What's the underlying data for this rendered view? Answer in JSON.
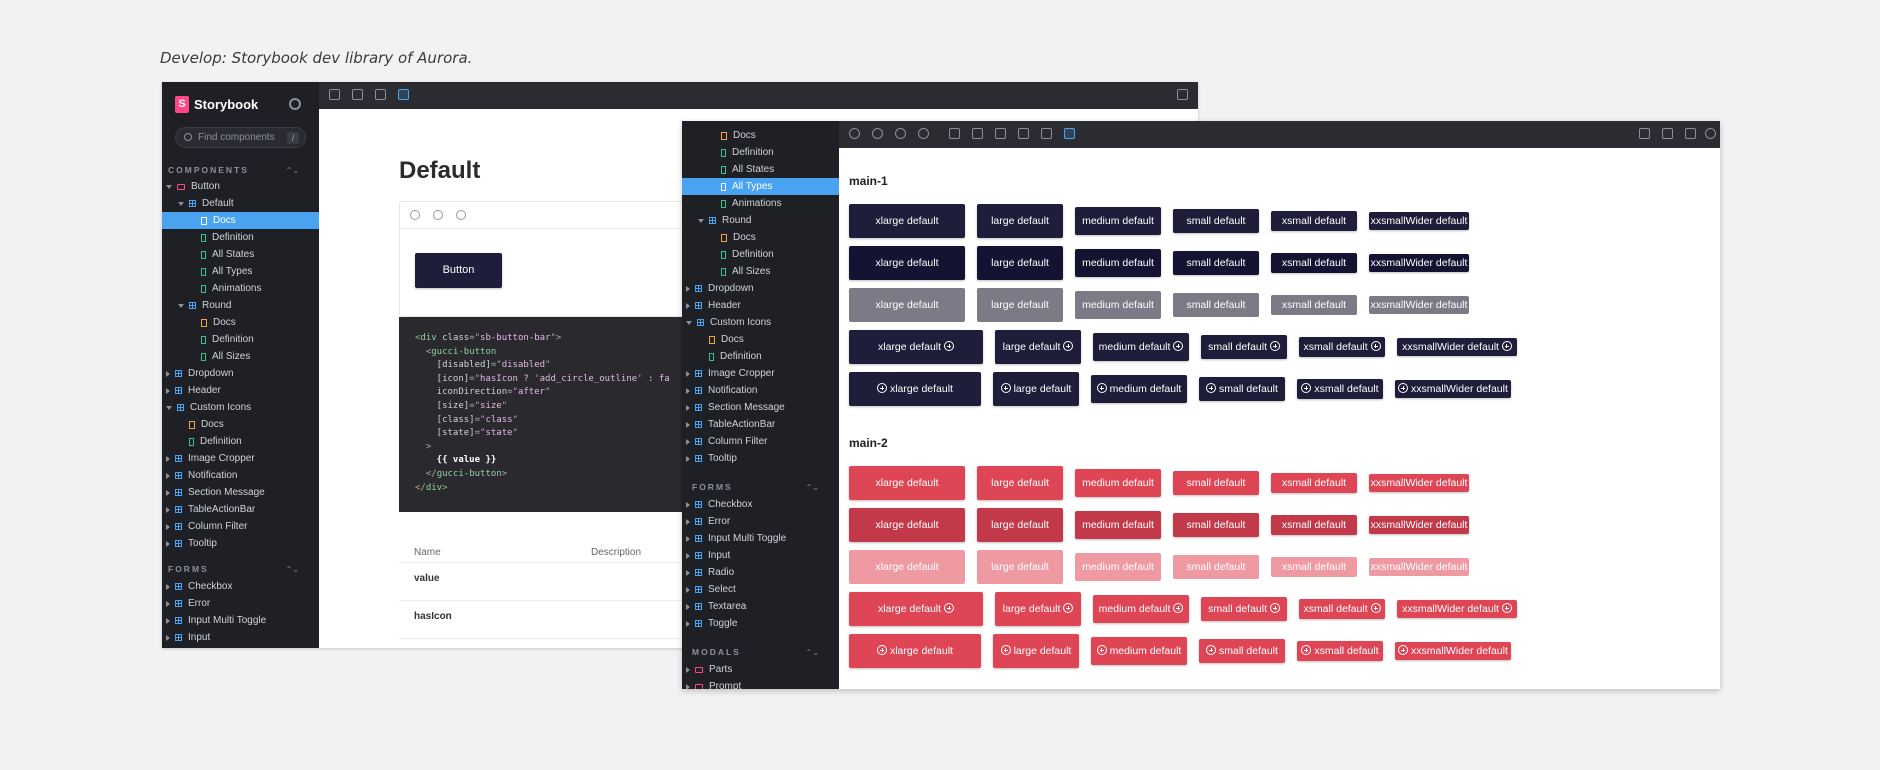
{
  "caption": "Develop: Storybook dev library of Aurora.",
  "storybook": {
    "brand": "Storybook",
    "search_placeholder": "Find components",
    "search_shortcut": "/",
    "section_components": "COMPONENTS",
    "section_forms": "FORMS",
    "section_modals": "MODALS"
  },
  "win1": {
    "tree": [
      {
        "label": "Button",
        "icon": "folder",
        "caret": "down",
        "indent": 0
      },
      {
        "label": "Default",
        "icon": "comp",
        "caret": "down",
        "indent": 1
      },
      {
        "label": "Docs",
        "icon": "doc",
        "indent": 2,
        "selected": true
      },
      {
        "label": "Definition",
        "icon": "story",
        "indent": 2
      },
      {
        "label": "All States",
        "icon": "story",
        "indent": 2
      },
      {
        "label": "All Types",
        "icon": "story",
        "indent": 2
      },
      {
        "label": "Animations",
        "icon": "story",
        "indent": 2
      },
      {
        "label": "Round",
        "icon": "comp",
        "caret": "down",
        "indent": 1
      },
      {
        "label": "Docs",
        "icon": "doc",
        "indent": 2
      },
      {
        "label": "Definition",
        "icon": "story",
        "indent": 2
      },
      {
        "label": "All Sizes",
        "icon": "story",
        "indent": 2
      },
      {
        "label": "Dropdown",
        "icon": "comp",
        "caret": "right",
        "indent": 0
      },
      {
        "label": "Header",
        "icon": "comp",
        "caret": "right",
        "indent": 0
      },
      {
        "label": "Custom Icons",
        "icon": "comp",
        "caret": "down",
        "indent": 0
      },
      {
        "label": "Docs",
        "icon": "doc",
        "indent": 1
      },
      {
        "label": "Definition",
        "icon": "story",
        "indent": 1
      },
      {
        "label": "Image Cropper",
        "icon": "comp",
        "caret": "right",
        "indent": 0
      },
      {
        "label": "Notification",
        "icon": "comp",
        "caret": "right",
        "indent": 0
      },
      {
        "label": "Section Message",
        "icon": "comp",
        "caret": "right",
        "indent": 0
      },
      {
        "label": "TableActionBar",
        "icon": "comp",
        "caret": "right",
        "indent": 0
      },
      {
        "label": "Column Filter",
        "icon": "comp",
        "caret": "right",
        "indent": 0
      },
      {
        "label": "Tooltip",
        "icon": "comp",
        "caret": "right",
        "indent": 0
      }
    ],
    "forms_tree": [
      {
        "label": "Checkbox",
        "icon": "comp",
        "caret": "right",
        "indent": 0
      },
      {
        "label": "Error",
        "icon": "comp",
        "caret": "right",
        "indent": 0
      },
      {
        "label": "Input Multi Toggle",
        "icon": "comp",
        "caret": "right",
        "indent": 0
      },
      {
        "label": "Input",
        "icon": "comp",
        "caret": "right",
        "indent": 0
      }
    ],
    "docs_title": "Default",
    "preview_button_label": "Button",
    "code_lines": [
      [
        [
          "c-pun",
          "<"
        ],
        [
          "c-tag",
          "div "
        ],
        [
          "c-attr",
          "class"
        ],
        [
          "c-pun",
          "=\""
        ],
        [
          "c-str",
          "sb-button-bar"
        ],
        [
          "c-pun",
          "\">"
        ]
      ],
      [
        [
          "c-pun",
          "  <"
        ],
        [
          "c-tag",
          "gucci-button"
        ]
      ],
      [
        [
          "c-attr",
          "    [disabled]"
        ],
        [
          "c-pun",
          "=\""
        ],
        [
          "c-str",
          "disabled"
        ],
        [
          "c-pun",
          "\""
        ]
      ],
      [
        [
          "c-attr",
          "    [icon]"
        ],
        [
          "c-pun",
          "=\""
        ],
        [
          "c-str",
          "hasIcon ? 'add_circle_outline' : fa"
        ]
      ],
      [
        [
          "c-attr",
          "    iconDirection"
        ],
        [
          "c-pun",
          "=\""
        ],
        [
          "c-str",
          "after"
        ],
        [
          "c-pun",
          "\""
        ]
      ],
      [
        [
          "c-attr",
          "    [size]"
        ],
        [
          "c-pun",
          "=\""
        ],
        [
          "c-str",
          "size"
        ],
        [
          "c-pun",
          "\""
        ]
      ],
      [
        [
          "c-attr",
          "    [class]"
        ],
        [
          "c-pun",
          "=\""
        ],
        [
          "c-str",
          "class"
        ],
        [
          "c-pun",
          "\""
        ]
      ],
      [
        [
          "c-attr",
          "    [state]"
        ],
        [
          "c-pun",
          "=\""
        ],
        [
          "c-str",
          "state"
        ],
        [
          "c-pun",
          "\""
        ]
      ],
      [
        [
          "c-pun",
          "  >"
        ]
      ],
      [
        [
          "c-bold",
          "    {{ value }}"
        ]
      ],
      [
        [
          "c-pun",
          "  </"
        ],
        [
          "c-tag",
          "gucci-button"
        ],
        [
          "c-pun",
          ">"
        ]
      ],
      [
        [
          "c-pun",
          "</"
        ],
        [
          "c-tag",
          "div"
        ],
        [
          "c-pun",
          ">"
        ]
      ]
    ],
    "props_headers": {
      "name": "Name",
      "description": "Description"
    },
    "props_rows": [
      "value",
      "hasIcon"
    ]
  },
  "win2": {
    "tree": [
      {
        "label": "Docs",
        "icon": "doc",
        "indent": 2
      },
      {
        "label": "Definition",
        "icon": "story",
        "indent": 2
      },
      {
        "label": "All States",
        "icon": "story",
        "indent": 2
      },
      {
        "label": "All Types",
        "icon": "story",
        "indent": 2,
        "selected": true
      },
      {
        "label": "Animations",
        "icon": "story",
        "indent": 2
      },
      {
        "label": "Round",
        "icon": "comp",
        "caret": "down",
        "indent": 1
      },
      {
        "label": "Docs",
        "icon": "doc",
        "indent": 2
      },
      {
        "label": "Definition",
        "icon": "story",
        "indent": 2
      },
      {
        "label": "All Sizes",
        "icon": "story",
        "indent": 2
      },
      {
        "label": "Dropdown",
        "icon": "comp",
        "caret": "right",
        "indent": 0
      },
      {
        "label": "Header",
        "icon": "comp",
        "caret": "right",
        "indent": 0
      },
      {
        "label": "Custom Icons",
        "icon": "comp",
        "caret": "down",
        "indent": 0
      },
      {
        "label": "Docs",
        "icon": "doc",
        "indent": 1
      },
      {
        "label": "Definition",
        "icon": "story",
        "indent": 1
      },
      {
        "label": "Image Cropper",
        "icon": "comp",
        "caret": "right",
        "indent": 0
      },
      {
        "label": "Notification",
        "icon": "comp",
        "caret": "right",
        "indent": 0
      },
      {
        "label": "Section Message",
        "icon": "comp",
        "caret": "right",
        "indent": 0
      },
      {
        "label": "TableActionBar",
        "icon": "comp",
        "caret": "right",
        "indent": 0
      },
      {
        "label": "Column Filter",
        "icon": "comp",
        "caret": "right",
        "indent": 0
      },
      {
        "label": "Tooltip",
        "icon": "comp",
        "caret": "right",
        "indent": 0
      }
    ],
    "forms_tree": [
      {
        "label": "Checkbox",
        "icon": "comp",
        "caret": "right",
        "indent": 0
      },
      {
        "label": "Error",
        "icon": "comp",
        "caret": "right",
        "indent": 0
      },
      {
        "label": "Input Multi Toggle",
        "icon": "comp",
        "caret": "right",
        "indent": 0
      },
      {
        "label": "Input",
        "icon": "comp",
        "caret": "right",
        "indent": 0
      },
      {
        "label": "Radio",
        "icon": "comp",
        "caret": "right",
        "indent": 0
      },
      {
        "label": "Select",
        "icon": "comp",
        "caret": "right",
        "indent": 0
      },
      {
        "label": "Textarea",
        "icon": "comp",
        "caret": "right",
        "indent": 0
      },
      {
        "label": "Toggle",
        "icon": "comp",
        "caret": "right",
        "indent": 0
      }
    ],
    "modals_tree": [
      {
        "label": "Parts",
        "icon": "folder",
        "caret": "right",
        "indent": 0
      },
      {
        "label": "Prompt",
        "icon": "folder",
        "caret": "right",
        "indent": 0
      }
    ],
    "groups": [
      {
        "title": "main-1",
        "colors": [
          "#1e1d3a",
          "#141331",
          "#7b7a86"
        ]
      },
      {
        "title": "main-2",
        "colors": [
          "#de4656",
          "#c2394a",
          "#ef9aa3"
        ]
      }
    ],
    "button_labels": [
      "xlarge default",
      "large default",
      "medium default",
      "small default",
      "xsmall default",
      "xxsmallWider default"
    ]
  },
  "colors": {
    "storybook_pink": "#ff4785",
    "selection_blue": "#4aa3f0",
    "sidebar_bg": "#1f2025"
  }
}
